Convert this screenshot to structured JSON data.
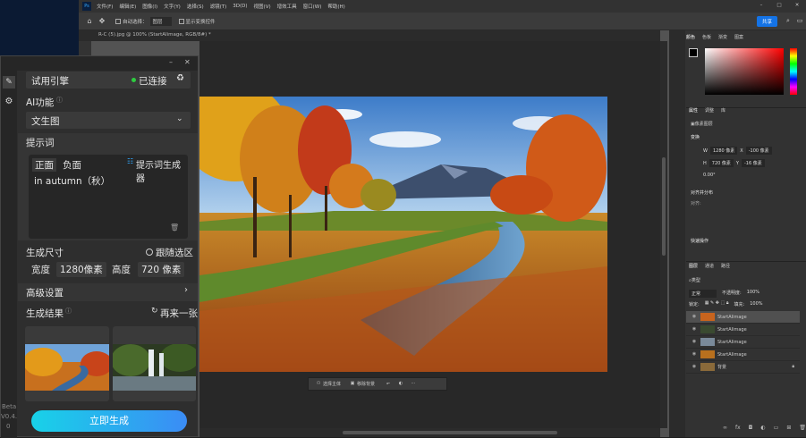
{
  "ps": {
    "menu": [
      "文件(F)",
      "编辑(E)",
      "图像(I)",
      "文字(Y)",
      "选择(S)",
      "滤镜(T)",
      "3D(D)",
      "视图(V)",
      "增效工具",
      "窗口(W)",
      "帮助(H)"
    ],
    "options": {
      "auto_select": "自动选择：",
      "layer_select": "图层",
      "transform": "显示变换控件",
      "share": "共享"
    },
    "doc_tab": "R-C (5).jpg @ 100% (StartAIimage, RGB/8#) *",
    "contextbar": {
      "select_subject": "选择主体",
      "remove_bg": "移除背景"
    },
    "color_tabs": [
      "颜色",
      "色板",
      "渐变",
      "图案"
    ],
    "props": {
      "tabs": [
        "属性",
        "调整",
        "库"
      ],
      "doc_label": "像素图层",
      "transform_title": "变换",
      "w_label": "W",
      "w_val": "1280 像素",
      "x_label": "X",
      "x_val": "-100 像素",
      "h_label": "H",
      "h_val": "720 像素",
      "y_label": "Y",
      "y_val": "-16 像素",
      "angle": "0.00°",
      "align_title": "对齐并分布",
      "align_label": "对齐:",
      "quick_title": "快速操作"
    },
    "layers": {
      "tabs": [
        "图层",
        "通道",
        "路径"
      ],
      "kind": "类型",
      "mode": "正常",
      "opacity_label": "不透明度:",
      "opacity": "100%",
      "lock_label": "锁定:",
      "fill_label": "填充:",
      "fill": "100%",
      "items": [
        {
          "name": "StartAIimage"
        },
        {
          "name": "StartAIimage"
        },
        {
          "name": "StartAIimage"
        },
        {
          "name": "StartAIimage"
        },
        {
          "name": "背景"
        }
      ]
    }
  },
  "plugin": {
    "engine": "试用引擎",
    "status": "已连接",
    "status_color": "#2ecc40",
    "ai_label": "AI功能",
    "ai_value": "文生图",
    "prompt_title": "提示词",
    "tab_pos": "正面",
    "tab_neg": "负面",
    "gen_prompt": "提示词生成器",
    "prompt_text": "in autumn（秋）",
    "size_title": "生成尺寸",
    "follow_sel": "跟随选区",
    "width_label": "宽度",
    "width_val": "1280像素",
    "height_label": "高度",
    "height_val": "720 像素",
    "advanced": "高级设置",
    "results_title": "生成结果",
    "regen": "再来一张",
    "generate": "立即生成",
    "beta": "Beta",
    "version": "V0.4.",
    "version2": "0"
  }
}
